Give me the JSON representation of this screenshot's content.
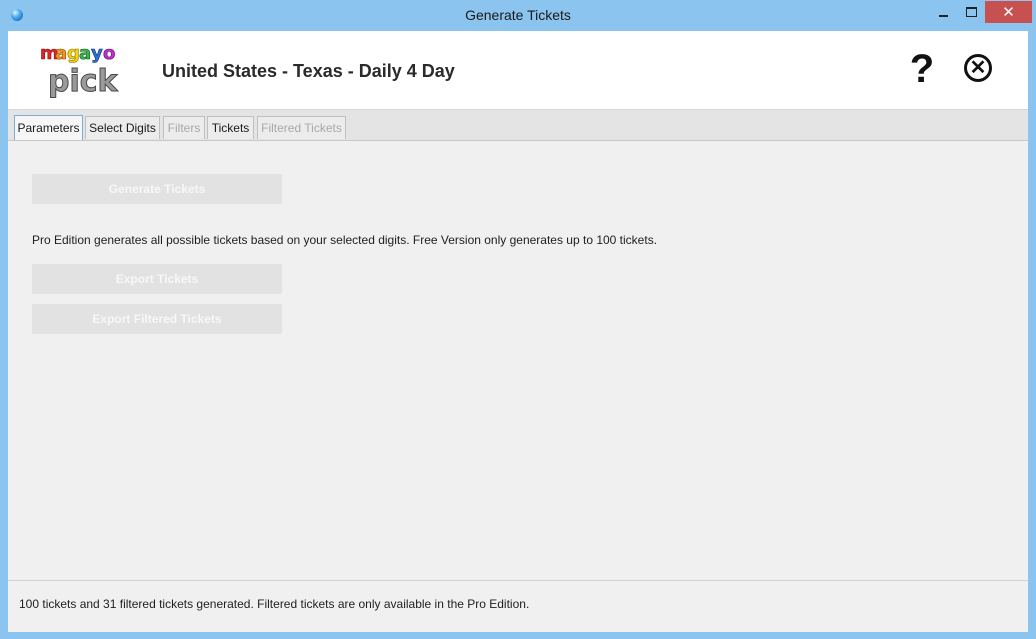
{
  "window": {
    "title": "Generate Tickets",
    "minimize": "minimize",
    "maximize": "maximize",
    "close": "✕"
  },
  "header": {
    "logo_text": [
      "magayo",
      "pick"
    ],
    "title": "United States - Texas - Daily 4 Day",
    "help": "?",
    "close": "✕"
  },
  "tabs": [
    {
      "label": "Parameters",
      "state": "active"
    },
    {
      "label": "Select Digits",
      "state": "enabled"
    },
    {
      "label": "Filters",
      "state": "disabled"
    },
    {
      "label": "Tickets",
      "state": "enabled"
    },
    {
      "label": "Filtered Tickets",
      "state": "disabled"
    }
  ],
  "main": {
    "generate_button": "Generate Tickets",
    "note": "Pro Edition generates all possible tickets based on your selected digits. Free Version only generates up to 100 tickets.",
    "export_button": "Export Tickets",
    "export_filtered_button": "Export Filtered Tickets"
  },
  "status": {
    "text": "100 tickets and 31 filtered tickets generated. Filtered tickets are only available in the Pro Edition."
  },
  "colors": {
    "window_frame": "#8cc4f0",
    "close_button": "#c75050",
    "active_tab_border": "#7aaed6",
    "disabled_button": "#e2e2e2"
  }
}
